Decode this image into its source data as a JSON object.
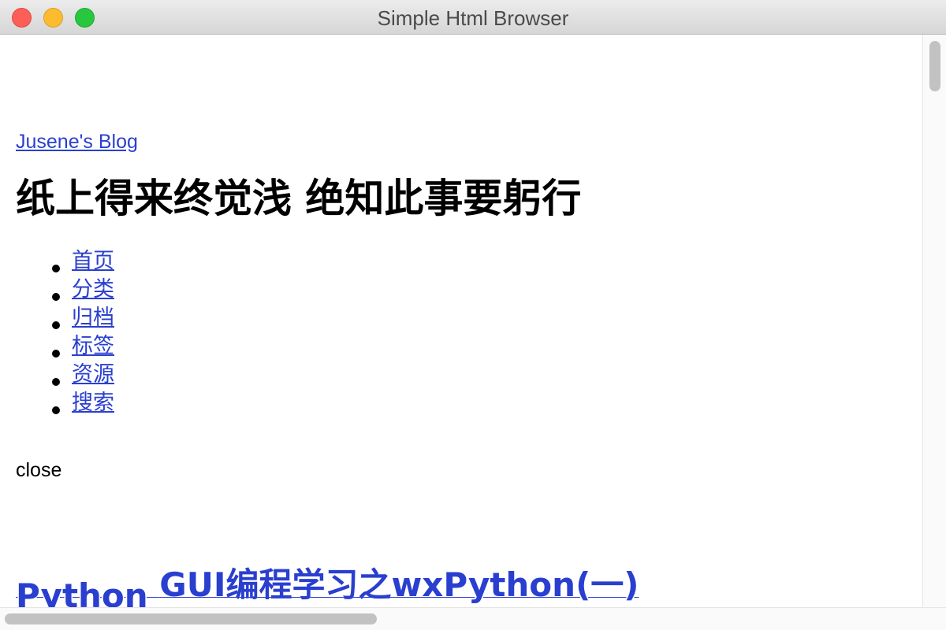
{
  "window": {
    "title": "Simple Html Browser"
  },
  "page": {
    "blog_link": "Jusene's Blog",
    "tagline": "纸上得来终觉浅 绝知此事要躬行",
    "nav": [
      {
        "label": "首页"
      },
      {
        "label": "分类"
      },
      {
        "label": "归档"
      },
      {
        "label": "标签"
      },
      {
        "label": "资源"
      },
      {
        "label": "搜索"
      }
    ],
    "close_label": "close",
    "post_title_part1": "Python ",
    "post_title_part2": "GUI编程学习之wxPython(一)"
  },
  "colors": {
    "link": "#2a3fcf",
    "traffic_close": "#fc5f57",
    "traffic_minimize": "#fdbc2e",
    "traffic_maximize": "#29c73f"
  }
}
